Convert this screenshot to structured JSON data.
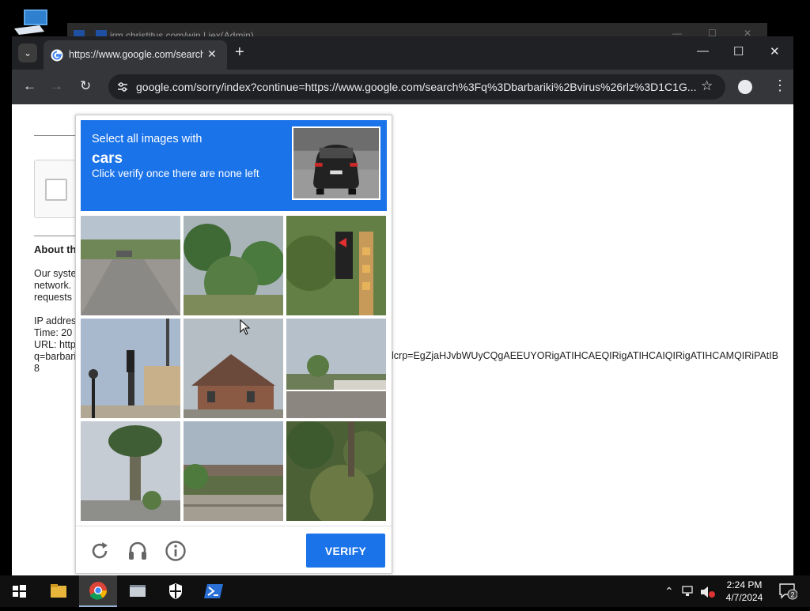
{
  "background_window": {
    "title": "irm christitus.com/win | iex(Admin)"
  },
  "browser": {
    "tab_title": "https://www.google.com/search?",
    "tab_close": "✕",
    "new_tab": "+",
    "tab_search": "⌄",
    "minimize": "—",
    "maximize": "☐",
    "close": "✕",
    "back": "←",
    "forward": "→",
    "reload": "↻",
    "url": "google.com/sorry/index?continue=https://www.google.com/search%3Fq%3Dbarbariki%2Bvirus%26rlz%3D1C1G...",
    "bookmark": "☆",
    "menu": "⋮"
  },
  "page": {
    "about_heading": "About th",
    "para1": [
      "Our syste",
      "network.",
      "requests"
    ],
    "info": [
      "IP addres",
      "Time: 20",
      "URL: http",
      "q=barbari",
      "8"
    ],
    "url_tail": "lcrp=EgZjaHJvbWUyCQgAEEUYORigATIHCAEQIRigATIHCAIQIRigATIHCAMQIRiPAtIB"
  },
  "captcha": {
    "line1": "Select all images with",
    "target": "cars",
    "line3": "Click verify once there are none left",
    "verify_label": "VERIFY",
    "tiles": [
      "street-road",
      "trees",
      "traffic-light-palm",
      "traffic-light-building",
      "brick-house",
      "street-houses",
      "palm-tree",
      "bridge",
      "bushes"
    ]
  },
  "taskbar": {
    "time": "2:24 PM",
    "date": "4/7/2024",
    "notifications": "2",
    "apps": [
      "start",
      "file-explorer",
      "chrome",
      "app-generic",
      "windows-security",
      "powershell"
    ]
  },
  "colors": {
    "accent": "#1a73e8",
    "chrome_dark": "#35363a",
    "taskbar": "#101010"
  }
}
